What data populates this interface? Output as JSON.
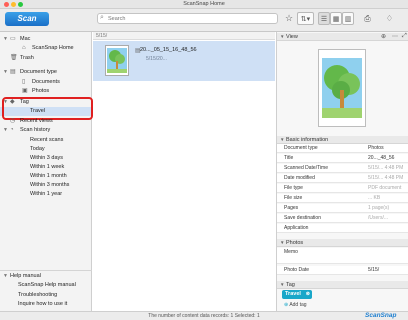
{
  "window": {
    "title": "ScanSnap Home"
  },
  "toolbar": {
    "scan_label": "Scan",
    "search_placeholder": "Search",
    "icons": [
      "star-icon",
      "sort-icon",
      "list-view-icon",
      "grid-view-icon",
      "columns-view-icon",
      "print-icon",
      "notification-icon"
    ]
  },
  "sidebar": {
    "mac_label": "Mac",
    "home_label": "ScanSnap Home",
    "trash_label": "Trash",
    "doctype_label": "Document type",
    "documents_label": "Documents",
    "photos_label": "Photos",
    "tag_label": "Tag",
    "travel_label": "Travel",
    "recent_label": "Recent views",
    "history_label": "Scan history",
    "history_items": [
      "Recent scans",
      "Today",
      "Within 3 days",
      "Within 1 week",
      "Within 1 month",
      "Within 3 months",
      "Within 1 year"
    ],
    "help_label": "Help manual",
    "help_items": [
      "ScanSnap Help manual",
      "Troubleshooting",
      "Inquire how to use it"
    ]
  },
  "content_list": {
    "path": "5/15/",
    "item_name": "20..._05_15_16_48_56",
    "item_date": "5/15/20..."
  },
  "right_panel": {
    "view_label": "View",
    "basic_label": "Basic information",
    "properties": [
      {
        "key": "Document type",
        "value": "Photos"
      },
      {
        "key": "Title",
        "value": "20..._48_56"
      },
      {
        "key": "Scanned Date/Time",
        "value": "5/15/... 4:48 PM"
      },
      {
        "key": "Date modified",
        "value": "5/15/... 4:48 PM"
      },
      {
        "key": "File type",
        "value": "PDF document"
      },
      {
        "key": "File size",
        "value": "... KB"
      },
      {
        "key": "Pages",
        "value": "1 page(s)"
      },
      {
        "key": "Save destination",
        "value": "/Users/..."
      },
      {
        "key": "Application",
        "value": ""
      }
    ],
    "photos_label": "Photos",
    "memo_label": "Memo",
    "photo_date_label": "Photo Date",
    "photo_date_value": "5/15/",
    "tag_label": "Tag",
    "tag_chip": "Travel",
    "add_tag": "Add tag"
  },
  "status": {
    "text": "The number of content data records: 1 Selected: 1",
    "logo": "ScanSnap"
  },
  "colors": {
    "accent": "#1a6fc7",
    "selection": "#cfe0f5",
    "highlight": "#e02020",
    "tag": "#19a7c9"
  }
}
